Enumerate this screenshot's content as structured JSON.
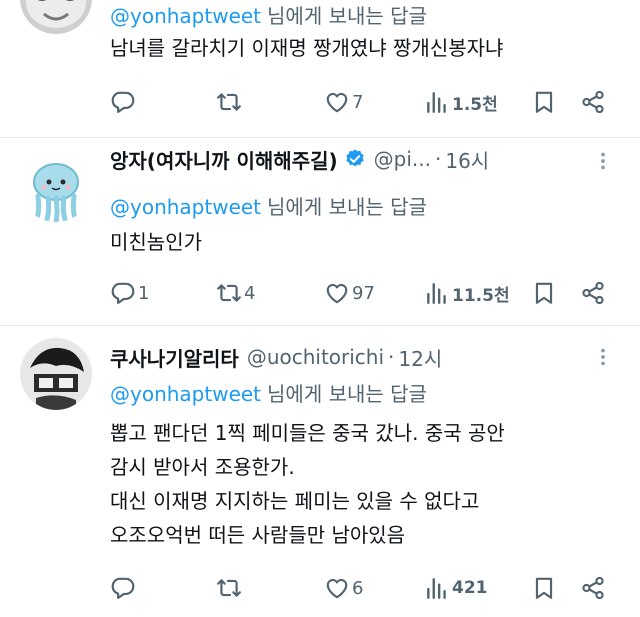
{
  "suffix": "님에게 보내는 답글",
  "tweets": [
    {
      "reply_to": "@yonhaptweet",
      "text": [
        "남녀를 갈라치기 이재명  짱개였냐 짱개신봉자냐"
      ],
      "reply_count": "",
      "retweet_count": "",
      "like_count": "7",
      "view_count": "1.5천"
    },
    {
      "name": "앙자(여자니까 이해해주길)",
      "handle": "@pi...",
      "time": "16시",
      "reply_to": "@yonhaptweet",
      "text": [
        "미친놈인가"
      ],
      "reply_count": "1",
      "retweet_count": "4",
      "like_count": "97",
      "view_count": "11.5천"
    },
    {
      "name": "쿠사나기알리타",
      "handle": "@uochitorichi",
      "time": "12시",
      "reply_to": "@yonhaptweet",
      "text": [
        "뽑고 팬다던 1찍 페미들은 중국 갔나. 중국 공안",
        "감시 받아서 조용한가.",
        "대신 이재명 지지하는 페미는 있을 수 없다고",
        "오조오억번 떠든 사람들만 남아있음"
      ],
      "reply_count": "",
      "retweet_count": "",
      "like_count": "6",
      "view_count": "421"
    }
  ],
  "colors": {
    "link": "#1d9bf0",
    "secondary": "#536471",
    "text": "#0f1419",
    "verified": "#1d9bf0",
    "divider": "#e6e9eb"
  },
  "icons": [
    "reply-icon",
    "retweet-icon",
    "like-icon",
    "views-icon",
    "bookmark-icon",
    "share-icon",
    "verified-badge-icon",
    "more-icon"
  ]
}
